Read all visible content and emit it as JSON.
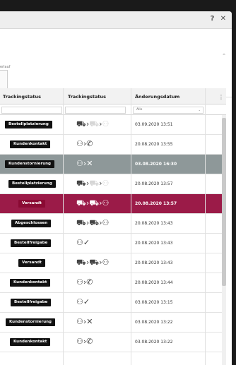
{
  "window": {
    "controls": [
      "?",
      "✕"
    ]
  },
  "panel": {
    "label": "erlauf"
  },
  "table": {
    "columns": [
      "Trackingstatus",
      "Trackingstatus",
      "Änderungsdatum"
    ],
    "filter": {
      "date_filter": "Alle"
    },
    "more_icon": "⋮",
    "rows": [
      {
        "status": "Bestellplatzierung",
        "icons": "box-chevron-truck-chevron-person",
        "date": "03.09.2020 13:51"
      },
      {
        "status": "Kundenkontakt",
        "icons": "person-chevron-phone",
        "date": "20.08.2020 13:55"
      },
      {
        "status": "Kundenstornierung",
        "icons": "person-chevron-x",
        "date": "03.08.2020 16:30"
      },
      {
        "status": "Bestellplatzierung",
        "icons": "box-chevron-truck-chevron-person",
        "date": "20.08.2020 13:57"
      },
      {
        "status": "Versandt",
        "icons": "box-chevron-truck-chevron-person",
        "date": "20.08.2020 13:57"
      },
      {
        "status": "Abgeschlossen",
        "icons": "box-chevron-truck-chevron-person",
        "date": "20.08.2020 13:43"
      },
      {
        "status": "Bestellfreigabe",
        "icons": "person-check",
        "date": "20.08.2020 13:43"
      },
      {
        "status": "Versandt",
        "icons": "box-chevron-truck-chevron-person",
        "date": "20.08.2020 13:43"
      },
      {
        "status": "Kundenkontakt",
        "icons": "person-chevron-phone",
        "date": "20.08.2020 13:44"
      },
      {
        "status": "Bestellfreigabe",
        "icons": "person-check",
        "date": "03.08.2020 13:15"
      },
      {
        "status": "Kundenstornierung",
        "icons": "person-chevron-x",
        "date": "03.08.2020 13:22"
      },
      {
        "status": "Kundenkontakt",
        "icons": "person-chevron-phone",
        "date": "03.08.2020 13:22"
      }
    ]
  }
}
